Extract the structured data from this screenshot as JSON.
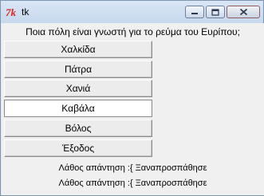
{
  "window": {
    "title": "tk",
    "controls": {
      "minimize_icon": "minimize-icon",
      "maximize_icon": "maximize-icon",
      "close_icon": "close-icon"
    }
  },
  "question": "Ποια πόλη είναι γνωστή για το ρεύμα του Ευρίπου;",
  "answers": [
    {
      "label": "Χαλκίδα"
    },
    {
      "label": "Πάτρα"
    },
    {
      "label": "Χανιά"
    },
    {
      "label": "Καβάλα"
    },
    {
      "label": "Βόλος"
    },
    {
      "label": "Έξοδος"
    }
  ],
  "messages": [
    "Λάθος απάντηση :{ Ξαναπροσπάθησε",
    "Λάθος απάντηση :{ Ξαναπροσπάθησε"
  ],
  "colors": {
    "titlebar": "#c7d8ee",
    "client_bg": "#f0f0f0",
    "button_bg": "#ececec",
    "app_icon": "#d7261e"
  }
}
